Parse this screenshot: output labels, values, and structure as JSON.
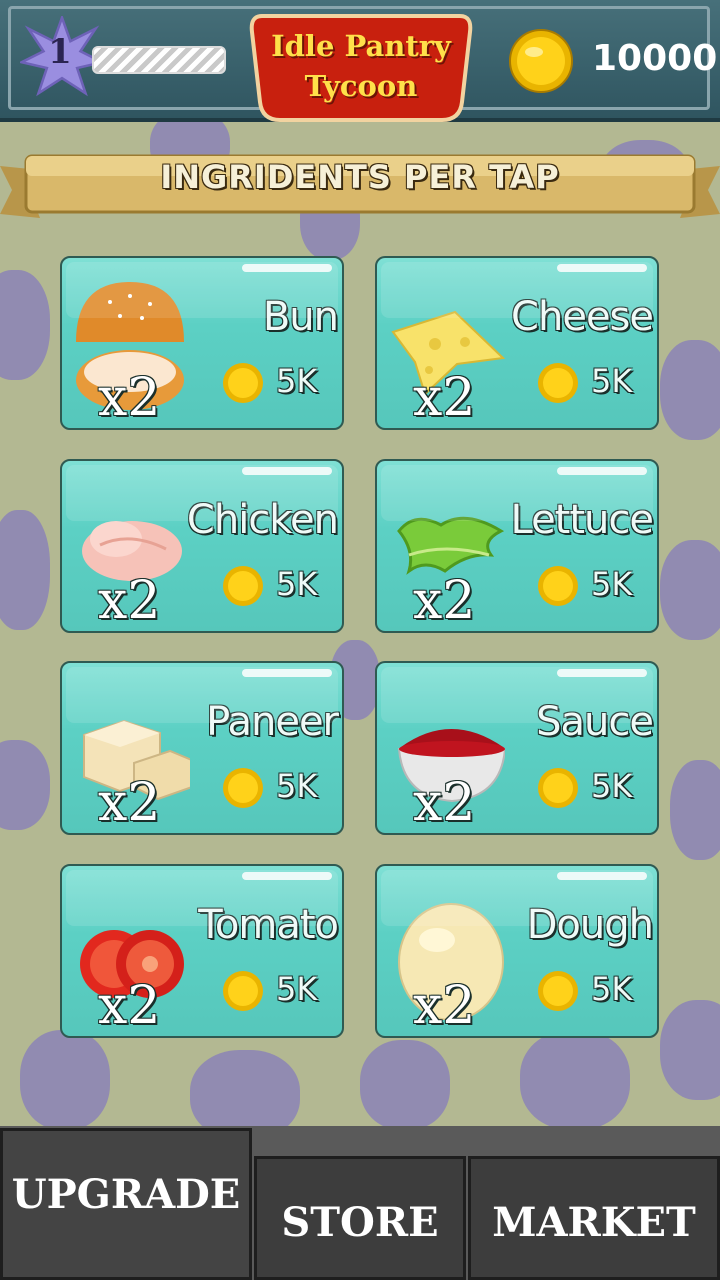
{
  "header": {
    "level": "1",
    "xp_progress": 0,
    "game_title_line1": "Idle Pantry",
    "game_title_line2": "Tycoon",
    "coins": "10000"
  },
  "section": {
    "title": "INGRIDENTS PER TAP"
  },
  "ingredients": [
    {
      "name": "Bun",
      "price": "5K",
      "multiplier": "x2",
      "icon": "bun-icon"
    },
    {
      "name": "Cheese",
      "price": "5K",
      "multiplier": "x2",
      "icon": "cheese-icon"
    },
    {
      "name": "Chicken",
      "price": "5K",
      "multiplier": "x2",
      "icon": "chicken-icon"
    },
    {
      "name": "Lettuce",
      "price": "5K",
      "multiplier": "x2",
      "icon": "lettuce-icon"
    },
    {
      "name": "Paneer",
      "price": "5K",
      "multiplier": "x2",
      "icon": "paneer-icon"
    },
    {
      "name": "Sauce",
      "price": "5K",
      "multiplier": "x2",
      "icon": "sauce-icon"
    },
    {
      "name": "Tomato",
      "price": "5K",
      "multiplier": "x2",
      "icon": "tomato-icon"
    },
    {
      "name": "Dough",
      "price": "5K",
      "multiplier": "x2",
      "icon": "dough-icon"
    }
  ],
  "nav": {
    "upgrade_label": "UPGRADE",
    "store_label": "STORE",
    "market_label": "MARKET",
    "active": "UPGRADE"
  },
  "colors": {
    "card": "#5cd0c4",
    "background": "#b3b892",
    "pattern": "#8b82b6",
    "title_plate": "#c8200e",
    "title_text": "#ffe04a"
  }
}
